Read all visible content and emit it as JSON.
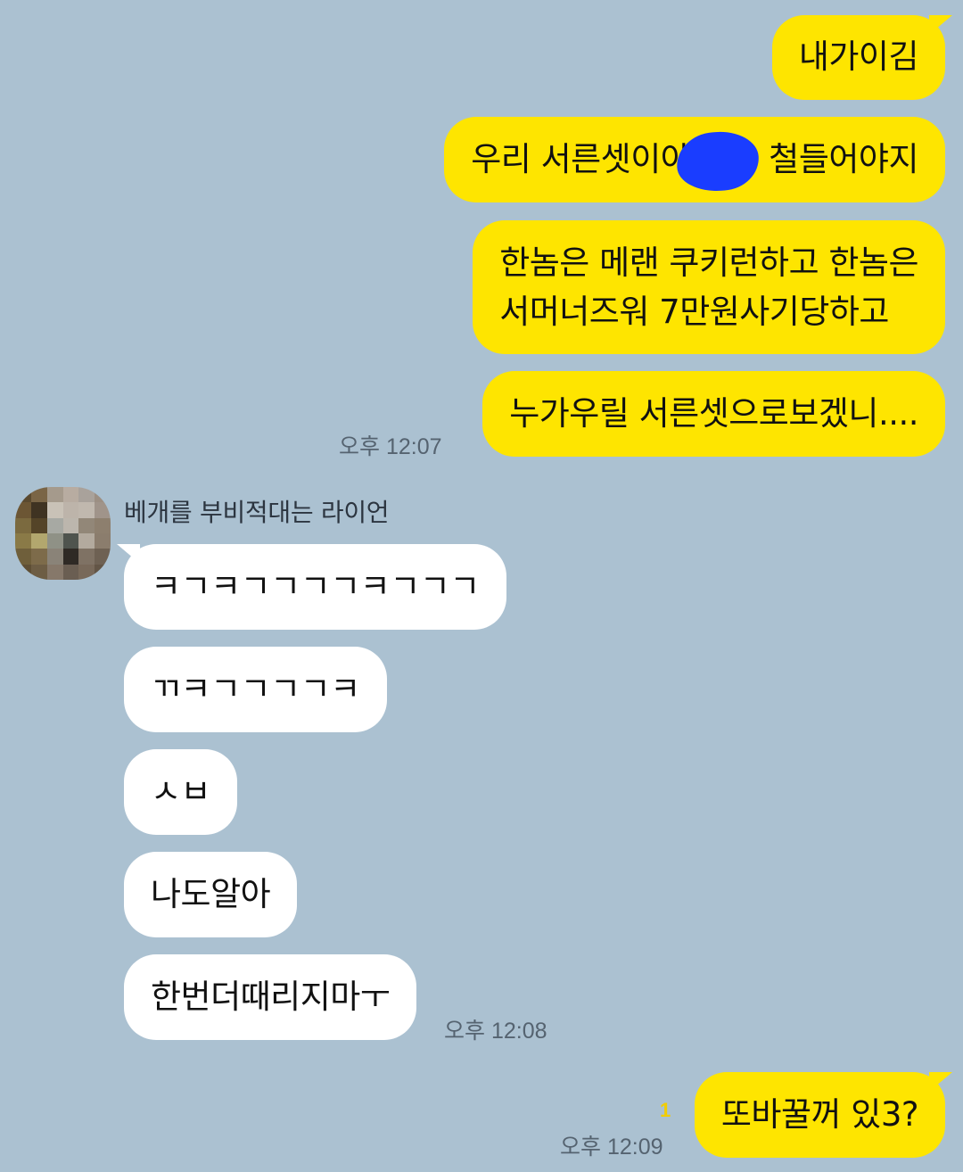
{
  "theme": {
    "background": "#abc1d1",
    "my_bubble": "#fee500",
    "their_bubble": "#ffffff",
    "censor_mark": "#1a3dff",
    "unread_color": "#f2cd00"
  },
  "messages_out_1": {
    "m1": "내가이김",
    "m2_before": "우리 서른셋이야",
    "m2_after": "철들어야지",
    "m3_line1": "한놈은 메랜 쿠키런하고 한놈은",
    "m3_line2": "서머너즈워 7만원사기당하고",
    "m4": "누가우릴 서른셋으로보겠니....",
    "time": "오후 12:07"
  },
  "incoming": {
    "sender_name": "베개를 부비적대는 라이언",
    "avatar_icon": "pixelated-avatar",
    "m1": "ㅋㄱㅋㄱㄱㄱㄱㅋㄱㄱㄱ",
    "m2": "ㄲㅋㄱㄱㄱㄱㅋ",
    "m3": "ㅅㅂ",
    "m4": "나도알아",
    "m5": "한번더때리지마ㅜ",
    "time": "오후 12:08"
  },
  "messages_out_2": {
    "m1": "또바꿀꺼 있3?",
    "unread_count": "1",
    "time": "오후 12:09"
  }
}
